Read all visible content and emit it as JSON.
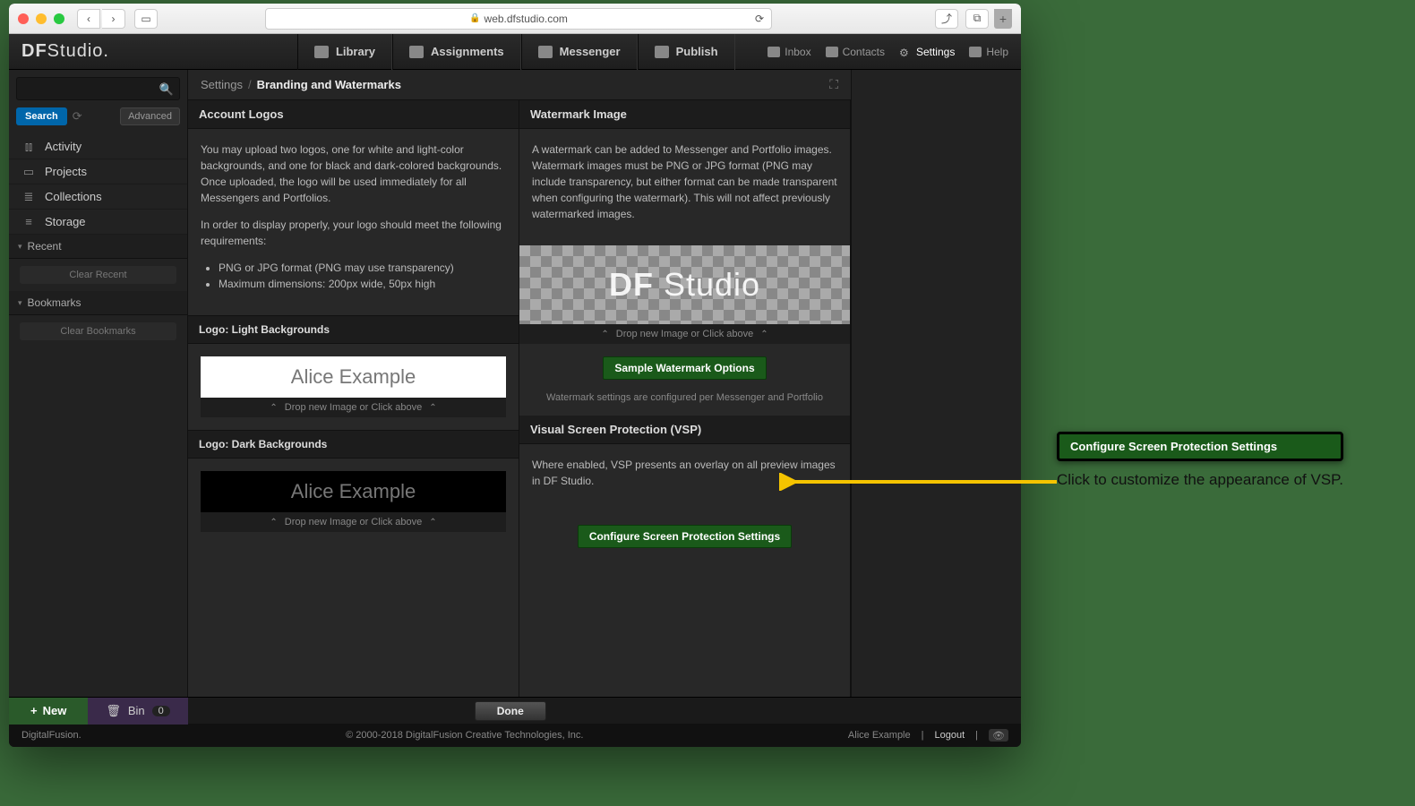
{
  "browser": {
    "url": "web.dfstudio.com"
  },
  "header": {
    "logo_a": "DF",
    "logo_b": "Studio.",
    "nav": {
      "library": "Library",
      "assignments": "Assignments",
      "messenger": "Messenger",
      "publish": "Publish"
    },
    "right": {
      "inbox": "Inbox",
      "contacts": "Contacts",
      "settings": "Settings",
      "help": "Help"
    }
  },
  "sidebar": {
    "search_btn": "Search",
    "advanced_btn": "Advanced",
    "items": {
      "activity": "Activity",
      "projects": "Projects",
      "collections": "Collections",
      "storage": "Storage"
    },
    "recent_header": "Recent",
    "clear_recent": "Clear Recent",
    "bookmarks_header": "Bookmarks",
    "clear_bookmarks": "Clear Bookmarks"
  },
  "breadcrumb": {
    "a": "Settings",
    "b": "Branding and Watermarks"
  },
  "left_panel": {
    "header": "Account Logos",
    "p1": "You may upload two logos, one for white and light-color backgrounds, and one for black and dark-colored backgrounds. Once uploaded, the logo will be used immediately for all Messengers and Portfolios.",
    "p2": "In order to display properly, your logo should meet the following requirements:",
    "li1": "PNG or JPG format (PNG may use transparency)",
    "li2": "Maximum dimensions: 200px wide, 50px high",
    "light_h": "Logo: Light Backgrounds",
    "dark_h": "Logo: Dark Backgrounds",
    "sample_logo": "Alice Example",
    "drop_hint": "Drop new Image or Click above"
  },
  "right_panel": {
    "wm_header": "Watermark Image",
    "wm_p": "A watermark can be added to Messenger and Portfolio images. Watermark images must be PNG or JPG format (PNG may include transparency, but either format can be made transparent when configuring the watermark). This will not affect previously watermarked images.",
    "wm_logo_a": "DF",
    "wm_logo_b": "Studio",
    "drop_hint": "Drop new Image or Click above",
    "sample_btn": "Sample Watermark Options",
    "wm_note": "Watermark settings are configured per Messenger and Portfolio",
    "vsp_header": "Visual Screen Protection (VSP)",
    "vsp_p": "Where enabled, VSP presents an overlay on all preview images in DF Studio.",
    "vsp_btn": "Configure Screen Protection Settings"
  },
  "bottom": {
    "new": "New",
    "bin": "Bin",
    "bin_count": "0",
    "done": "Done"
  },
  "status": {
    "brand": "DigitalFusion.",
    "copy": "© 2000-2018 DigitalFusion Creative Technologies, Inc.",
    "user": "Alice Example",
    "logout": "Logout"
  },
  "callout": {
    "btn": "Configure Screen Protection Settings",
    "text": "Click to customize the appearance of VSP."
  }
}
